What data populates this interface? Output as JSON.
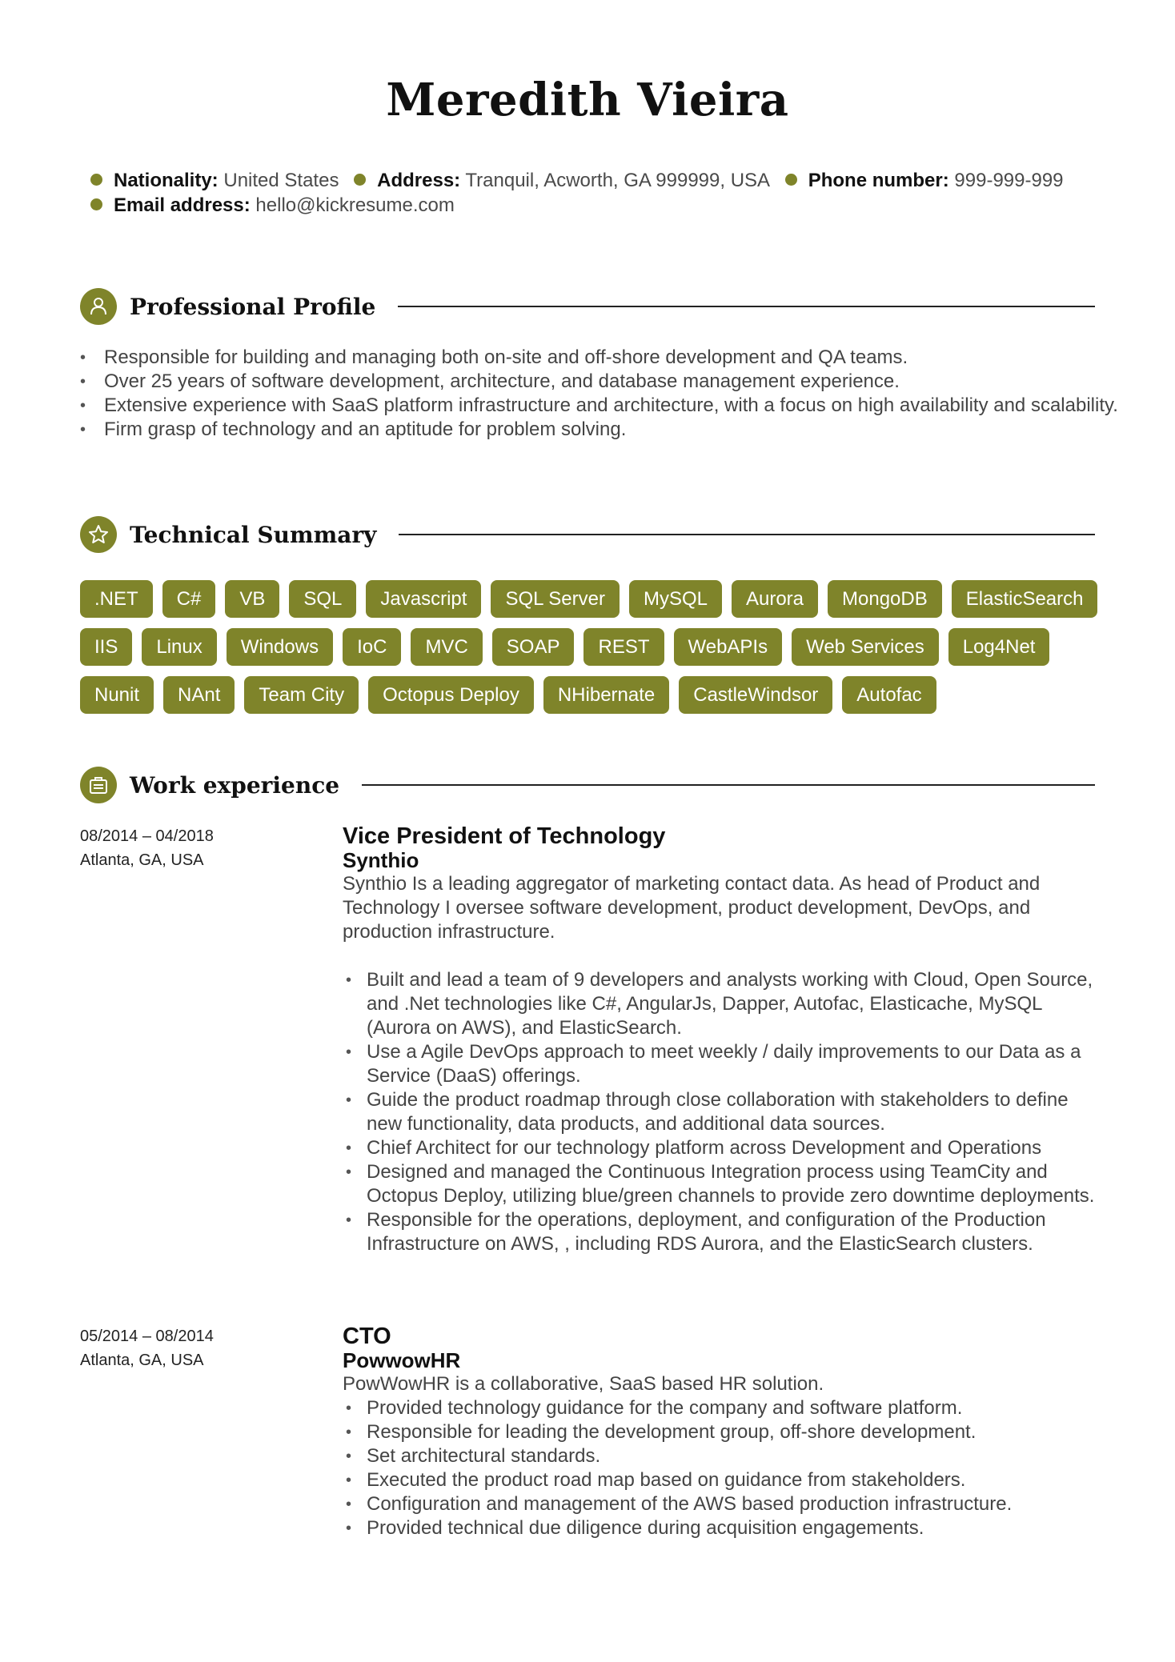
{
  "header": {
    "name": "Meredith Vieira",
    "contacts": [
      {
        "label": "Nationality:",
        "value": "United States"
      },
      {
        "label": "Address:",
        "value": "Tranquil, Acworth, GA 999999, USA"
      },
      {
        "label": "Phone number:",
        "value": "999-999-999"
      },
      {
        "label": "Email address:",
        "value": "hello@kickresume.com"
      }
    ]
  },
  "theme": {
    "accent": "#7f842a"
  },
  "sections": {
    "profile": {
      "title": "Professional Profile",
      "icon": "person-icon",
      "items": [
        "Responsible for building and managing both on-site and off-shore development and QA teams.",
        "Over 25 years of software development, architecture, and database management experience.",
        "Extensive experience with SaaS platform infrastructure and architecture, with a focus on high availability and scalability.",
        "Firm grasp of technology and an aptitude for problem solving."
      ]
    },
    "technical": {
      "title": "Technical Summary",
      "icon": "star-icon",
      "tags": [
        ".NET",
        "C#",
        "VB",
        "SQL",
        "Javascript",
        "SQL Server",
        "MySQL",
        "Aurora",
        "MongoDB",
        "ElasticSearch",
        "IIS",
        "Linux",
        "Windows",
        "IoC",
        "MVC",
        "SOAP",
        "REST",
        "WebAPIs",
        "Web Services",
        "Log4Net",
        "Nunit",
        "NAnt",
        "Team City",
        "Octopus Deploy",
        "NHibernate",
        "CastleWindsor",
        "Autofac"
      ]
    },
    "work": {
      "title": "Work experience",
      "icon": "briefcase-icon",
      "jobs": [
        {
          "dates": "08/2014 – 04/2018",
          "location": "Atlanta, GA, USA",
          "title": "Vice President of Technology",
          "company": "Synthio",
          "description": "Synthio Is a leading aggregator of marketing contact data. As head of Product and Technology I oversee software development, product development, DevOps, and production infrastructure.",
          "bullets": [
            "Built and lead a team of 9 developers and analysts working with Cloud, Open Source, and .Net technologies like C#, AngularJs, Dapper, Autofac, Elasticache, MySQL (Aurora on AWS), and ElasticSearch.",
            "Use a Agile DevOps approach to meet weekly / daily improvements to our Data as a Service (DaaS) offerings.",
            "Guide the product roadmap through close collaboration with stakeholders to define new functionality, data products, and additional data sources.",
            "Chief Architect for our technology platform across Development and Operations",
            "Designed and managed the Continuous Integration process using TeamCity and Octopus Deploy, utilizing blue/green channels to provide zero downtime deployments.",
            "Responsible for the operations, deployment, and configuration of the Production Infrastructure on AWS, , including RDS Aurora, and the  ElasticSearch clusters."
          ]
        },
        {
          "dates": "05/2014 – 08/2014",
          "location": "Atlanta, GA, USA",
          "title": "CTO",
          "company": "PowwowHR",
          "description": "PowWowHR is a collaborative, SaaS based HR solution.",
          "bullets": [
            "Provided technology guidance for the company and software platform.",
            "Responsible for leading the development group, off-shore development.",
            "Set architectural standards.",
            "Executed the product road map based on guidance from stakeholders.",
            "Configuration and management of the AWS based production infrastructure.",
            "Provided technical due diligence during acquisition engagements."
          ]
        }
      ]
    }
  }
}
